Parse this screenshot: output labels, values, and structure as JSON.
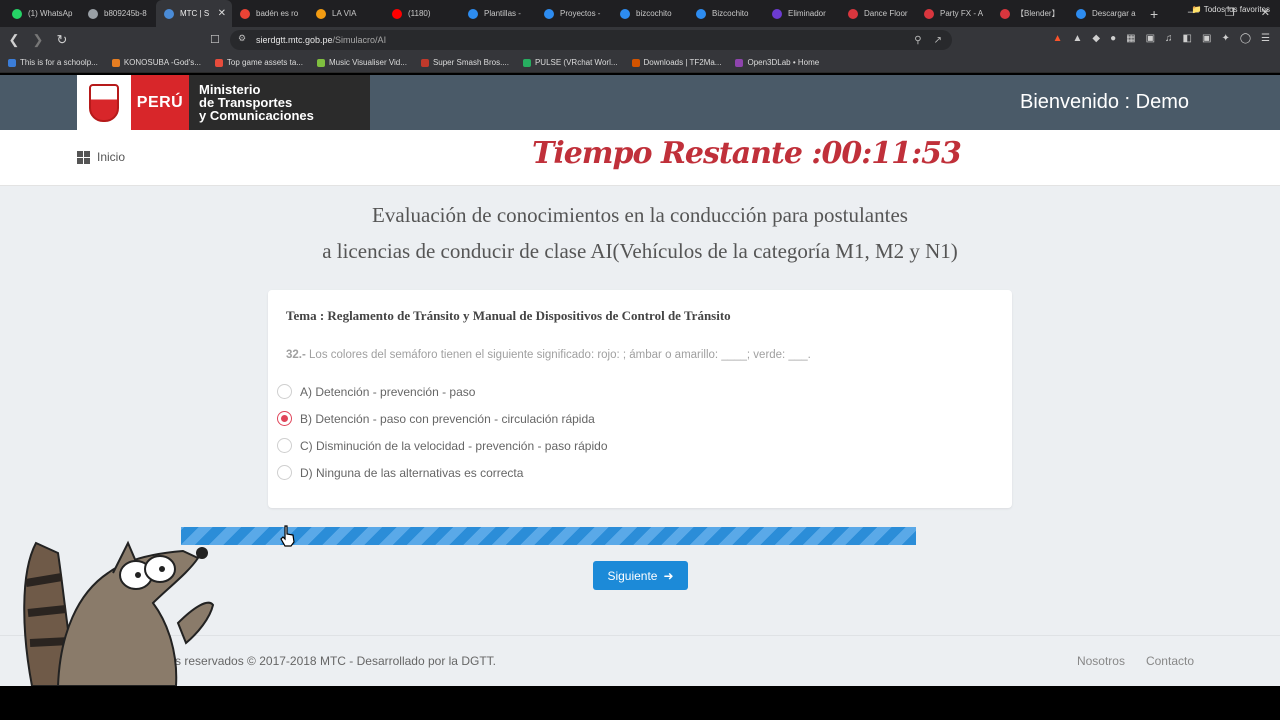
{
  "browser": {
    "tabs": [
      {
        "label": "(1) WhatsAp",
        "color": "#25d366"
      },
      {
        "label": "b809245b-8",
        "color": "#9aa0a6"
      },
      {
        "label": "MTC | S",
        "color": "#4a8bd6",
        "active": true
      },
      {
        "label": "badén es ro",
        "color": "#ea4335"
      },
      {
        "label": "LA VIA",
        "color": "#f39c12"
      },
      {
        "label": "(1180)",
        "color": "#ff0000"
      },
      {
        "label": "Plantillas -",
        "color": "#2d8cf0"
      },
      {
        "label": "Proyectos -",
        "color": "#2d8cf0"
      },
      {
        "label": "bizcochito",
        "color": "#2d8cf0"
      },
      {
        "label": "Bizcochito",
        "color": "#2d8cf0"
      },
      {
        "label": "Eliminador",
        "color": "#6c3bd1"
      },
      {
        "label": "Dance Floor",
        "color": "#d9363e"
      },
      {
        "label": "Party FX - A",
        "color": "#d9363e"
      },
      {
        "label": "【Blender】",
        "color": "#d9363e"
      },
      {
        "label": "Descargar a",
        "color": "#2d8cf0"
      }
    ],
    "new_tab": "+",
    "url_domain": "sierdgtt.mtc.gob.pe",
    "url_path": "/Simulacro/AI",
    "bookmarks": [
      {
        "label": "This is for a schoolp...",
        "color": "#3b7dd8"
      },
      {
        "label": "KONOSUBA -God's...",
        "color": "#e67e22"
      },
      {
        "label": "Top game assets ta...",
        "color": "#e74c3c"
      },
      {
        "label": "Music Visualiser Vid...",
        "color": "#7fbf3f"
      },
      {
        "label": "Super Smash Bros....",
        "color": "#c0392b"
      },
      {
        "label": "PULSE (VRchat Worl...",
        "color": "#27ae60"
      },
      {
        "label": "Downloads | TF2Ma...",
        "color": "#d35400"
      },
      {
        "label": "Open3DLab • Home",
        "color": "#8e44ad"
      }
    ],
    "bookmarks_right": "Todos los favoritos"
  },
  "header": {
    "logo_country": "PERÚ",
    "logo_line1": "Ministerio",
    "logo_line2": "de Transportes",
    "logo_line3": "y Comunicaciones",
    "welcome": "Bienvenido : Demo"
  },
  "subbar": {
    "inicio": "Inicio",
    "timer": "Tiempo Restante :00:11:53"
  },
  "main": {
    "title_line1": "Evaluación de conocimientos en la conducción para postulantes",
    "title_line2": "a licencias de conducir de clase AI(Vehículos de la categoría M1, M2 y N1)",
    "tema": "Tema : Reglamento de Tránsito y Manual de Dispositivos de Control de Tránsito",
    "question_number": "32.-",
    "question_text": " Los colores del semáforo tienen el siguiente significado: rojo: ; ámbar o amarillo: ____; verde: ___.",
    "options": [
      {
        "label": "A) Detención - prevención - paso",
        "checked": false
      },
      {
        "label": "B) Detención - paso con prevención - circulación rápida",
        "checked": true
      },
      {
        "label": "C) Disminución de la velocidad - prevención - paso rápido",
        "checked": false
      },
      {
        "label": "D) Ninguna de las alternativas es correcta",
        "checked": false
      }
    ],
    "progress": 1.0,
    "next_label": "Siguiente"
  },
  "footer": {
    "copyright": "rechos reservados © 2017-2018 MTC - Desarrollado por la DGTT.",
    "link1": "Nosotros",
    "link2": "Contacto"
  },
  "colors": {
    "header_bg": "#4a5a68",
    "timer": "#c0303a",
    "accent": "#1c8ad8",
    "radio_checked": "#e0455a"
  }
}
